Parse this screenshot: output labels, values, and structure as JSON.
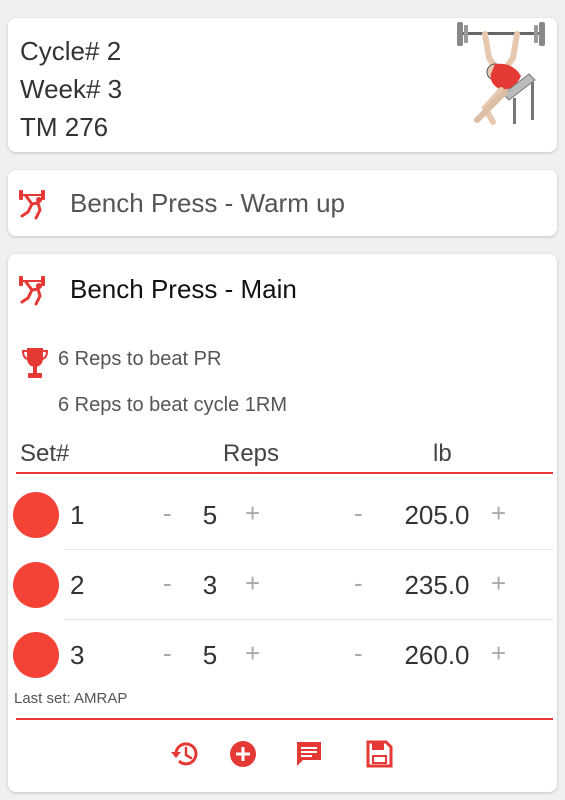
{
  "info": {
    "cycle": "Cycle# 2",
    "week": "Week# 3",
    "tm": "TM 276"
  },
  "warmup": {
    "title": "Bench Press - Warm up"
  },
  "main": {
    "title": "Bench Press - Main",
    "pr_text": "6 Reps to beat PR",
    "cycle_rm_text": "6 Reps to beat cycle 1RM",
    "headers": {
      "set": "Set#",
      "reps": "Reps",
      "weight": "lb"
    },
    "controls": {
      "minus": "-",
      "plus": "+"
    },
    "sets": [
      {
        "num": "1",
        "reps": "5",
        "weight": "205.0"
      },
      {
        "num": "2",
        "reps": "3",
        "weight": "235.0"
      },
      {
        "num": "3",
        "reps": "5",
        "weight": "260.0"
      }
    ],
    "last_set_note": "Last set: AMRAP"
  },
  "icons": {
    "lifter": "weightlifter-icon",
    "trophy": "trophy-icon",
    "history": "history-icon",
    "add": "add-circle-icon",
    "note": "comment-icon",
    "save": "save-icon"
  },
  "colors": {
    "accent": "#e53935",
    "set_dot": "#f44336"
  }
}
